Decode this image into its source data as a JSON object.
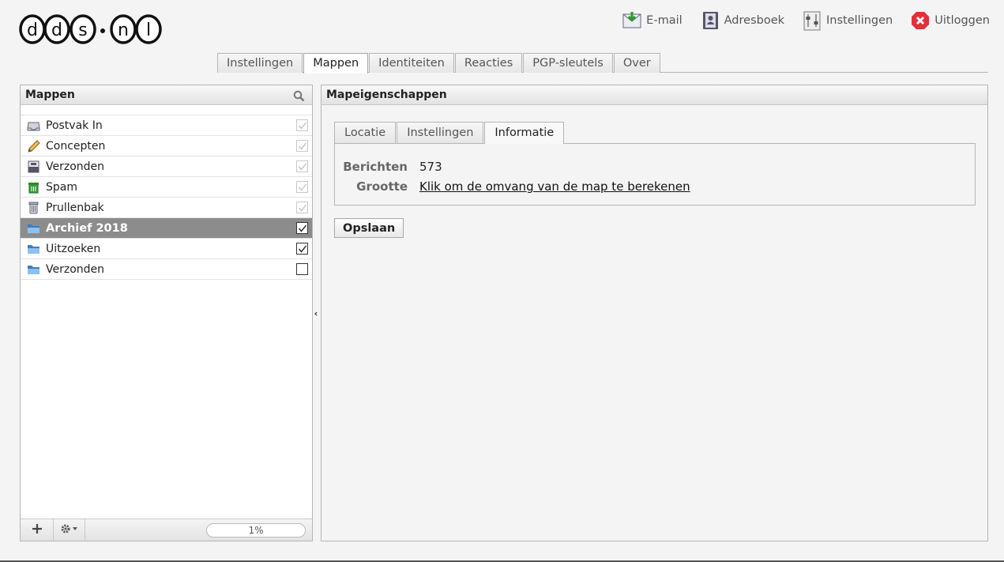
{
  "brand": {
    "logo_text": "dds.nl"
  },
  "topnav": [
    {
      "label": "E-mail",
      "icon": "email-icon"
    },
    {
      "label": "Adresboek",
      "icon": "addressbook-icon"
    },
    {
      "label": "Instellingen",
      "icon": "settings-icon"
    },
    {
      "label": "Uitloggen",
      "icon": "logout-icon"
    }
  ],
  "tabs": [
    {
      "label": "Instellingen",
      "active": false
    },
    {
      "label": "Mappen",
      "active": true
    },
    {
      "label": "Identiteiten",
      "active": false
    },
    {
      "label": "Reacties",
      "active": false
    },
    {
      "label": "PGP-sleutels",
      "active": false
    },
    {
      "label": "Over",
      "active": false
    }
  ],
  "folders_panel": {
    "title": "Mappen",
    "search_icon": "search-icon",
    "folders": [
      {
        "name": "Postvak In",
        "icon": "inbox-icon",
        "subscribed": true,
        "locked": true,
        "selected": false
      },
      {
        "name": "Concepten",
        "icon": "drafts-icon",
        "subscribed": true,
        "locked": true,
        "selected": false
      },
      {
        "name": "Verzonden",
        "icon": "sent-icon",
        "subscribed": true,
        "locked": true,
        "selected": false
      },
      {
        "name": "Spam",
        "icon": "spam-icon",
        "subscribed": true,
        "locked": true,
        "selected": false
      },
      {
        "name": "Prullenbak",
        "icon": "trash-icon",
        "subscribed": true,
        "locked": true,
        "selected": false
      },
      {
        "name": "Archief 2018",
        "icon": "folder-icon",
        "subscribed": true,
        "locked": false,
        "selected": true
      },
      {
        "name": "Uitzoeken",
        "icon": "folder-icon",
        "subscribed": true,
        "locked": false,
        "selected": false
      },
      {
        "name": "Verzonden",
        "icon": "folder-icon",
        "subscribed": false,
        "locked": false,
        "selected": false
      }
    ],
    "footer": {
      "add_icon": "plus-icon",
      "actions_icon": "gear-icon",
      "quota": "1%"
    }
  },
  "properties_panel": {
    "title": "Mapeigenschappen",
    "tabs": [
      {
        "label": "Locatie",
        "active": false
      },
      {
        "label": "Instellingen",
        "active": false
      },
      {
        "label": "Informatie",
        "active": true
      }
    ],
    "info": {
      "messages_label": "Berichten",
      "messages_value": "573",
      "size_label": "Grootte",
      "size_link": "Klik om de omvang van de map te berekenen"
    },
    "save_label": "Opslaan"
  }
}
